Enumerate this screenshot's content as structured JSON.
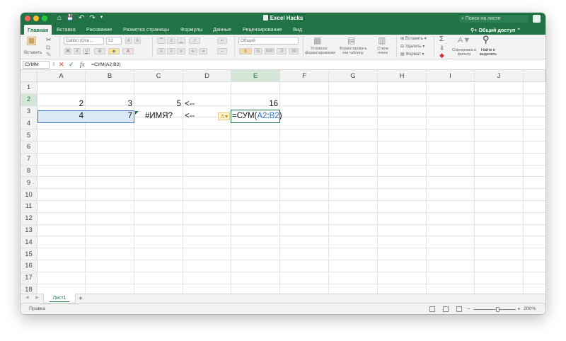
{
  "window": {
    "title": "Excel Hacks",
    "search_placeholder": "Поиск на листе",
    "qat": [
      "⌂",
      "💾",
      "↶",
      "↷",
      "▾"
    ]
  },
  "ribbon_tabs": [
    {
      "label": "Главная",
      "active": true
    },
    {
      "label": "Вставка"
    },
    {
      "label": "Рисование"
    },
    {
      "label": "Разметка страницы"
    },
    {
      "label": "Формулы"
    },
    {
      "label": "Данные"
    },
    {
      "label": "Рецензирование"
    },
    {
      "label": "Вид"
    }
  ],
  "share_label": "Общий доступ",
  "ribbon": {
    "paste_label": "Вставить",
    "font_name": "Calibri (Осн…",
    "font_size": "12",
    "number_format": "Общий",
    "cond_format_label": "Условное форматирование",
    "format_table_label": "Форматировать как таблицу",
    "cell_styles_label": "Стили ячеек",
    "insert_label": "Вставить",
    "delete_label": "Удалить",
    "format_label": "Формат",
    "sort_filter_label": "Сортировка и фильтр",
    "find_select_label": "Найти и выделить"
  },
  "formula_bar": {
    "name_box": "СУММ",
    "formula": "=СУМ(A2:B2)"
  },
  "columns": [
    "A",
    "B",
    "C",
    "D",
    "E",
    "F",
    "G",
    "H",
    "I",
    "J"
  ],
  "rows": [
    "1",
    "2",
    "3",
    "4",
    "5",
    "6",
    "7",
    "8",
    "9",
    "10",
    "11",
    "12",
    "13",
    "14",
    "15",
    "16",
    "17",
    "18"
  ],
  "cells": {
    "A1": "2",
    "B1": "3",
    "C1": "5",
    "D1": "<--",
    "E1": "16",
    "A2": "4",
    "B2": "7",
    "C2": "#ИМЯ?",
    "D2": "<--"
  },
  "edit_cell": {
    "prefix": "=СУМ(",
    "ref1": "A2",
    "sep": ":",
    "ref2": "B2",
    "suffix": ")"
  },
  "sheet_tab": "Лист1",
  "status": {
    "ready": "Правка",
    "zoom": "200%"
  },
  "colors": {
    "accent": "#217346",
    "selection": "#3f7bd1",
    "warning": "#c48a00"
  }
}
